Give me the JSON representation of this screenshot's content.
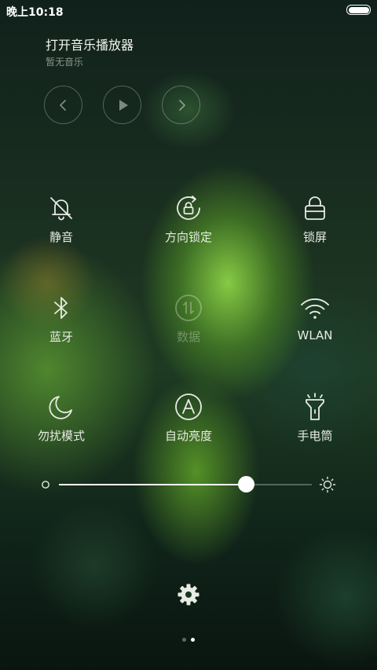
{
  "status_bar": {
    "time": "晚上10:18",
    "battery_icon": "battery-full-icon"
  },
  "music": {
    "title": "打开音乐播放器",
    "subtitle": "暂无音乐",
    "controls": [
      "prev-icon",
      "play-icon",
      "next-icon"
    ]
  },
  "toggles": [
    {
      "label": "静音",
      "icon": "bell-off-icon",
      "enabled": true
    },
    {
      "label": "方向锁定",
      "icon": "rotation-lock-icon",
      "enabled": true
    },
    {
      "label": "锁屏",
      "icon": "lock-icon",
      "enabled": true
    },
    {
      "label": "蓝牙",
      "icon": "bluetooth-icon",
      "enabled": true
    },
    {
      "label": "数据",
      "icon": "data-icon",
      "enabled": false
    },
    {
      "label": "WLAN",
      "icon": "wifi-icon",
      "enabled": true
    },
    {
      "label": "勿扰模式",
      "icon": "moon-icon",
      "enabled": true
    },
    {
      "label": "自动亮度",
      "icon": "auto-brightness-icon",
      "enabled": true
    },
    {
      "label": "手电筒",
      "icon": "flashlight-icon",
      "enabled": true
    }
  ],
  "brightness": {
    "level": 0.74,
    "low_icon": "brightness-low-icon",
    "high_icon": "brightness-high-icon"
  },
  "settings_icon": "gear-icon",
  "pager": {
    "pages": 2,
    "current": 2
  },
  "colors": {
    "text": "#e9eee6",
    "accent": "#ffffff",
    "disabled": "rgba(230,236,226,0.35)"
  }
}
